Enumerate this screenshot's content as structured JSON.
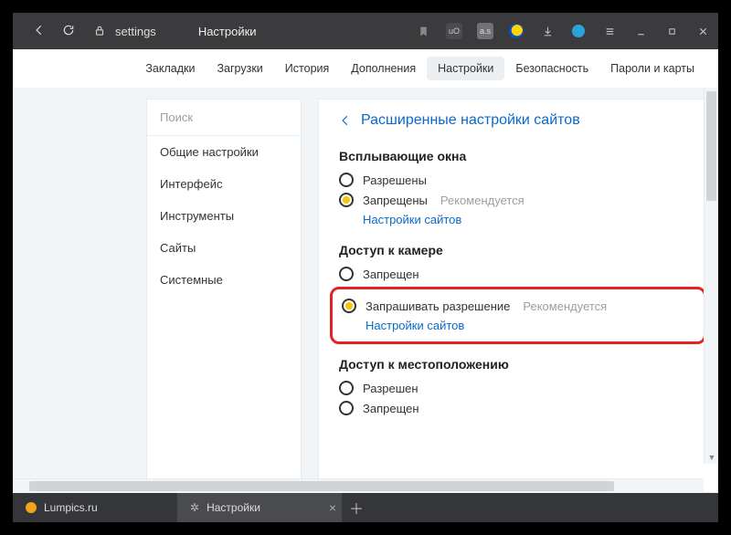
{
  "titlebar": {
    "address_text": "settings",
    "page_title": "Настройки"
  },
  "topTabs": {
    "items": [
      {
        "label": "Закладки"
      },
      {
        "label": "Загрузки"
      },
      {
        "label": "История"
      },
      {
        "label": "Дополнения"
      },
      {
        "label": "Настройки",
        "active": true
      },
      {
        "label": "Безопасность"
      },
      {
        "label": "Пароли и карты"
      }
    ]
  },
  "sidebar": {
    "search_placeholder": "Поиск",
    "items": [
      {
        "label": "Общие настройки"
      },
      {
        "label": "Интерфейс"
      },
      {
        "label": "Инструменты"
      },
      {
        "label": "Сайты"
      },
      {
        "label": "Системные"
      }
    ]
  },
  "main": {
    "breadcrumb_title": "Расширенные настройки сайтов",
    "popups": {
      "title": "Всплывающие окна",
      "opt_allow": "Разрешены",
      "opt_deny": "Запрещены",
      "recommended": "Рекомендуется",
      "link": "Настройки сайтов"
    },
    "camera": {
      "title": "Доступ к камере",
      "opt_deny": "Запрещен",
      "opt_ask": "Запрашивать разрешение",
      "recommended": "Рекомендуется",
      "link": "Настройки сайтов"
    },
    "location": {
      "title": "Доступ к местоположению",
      "opt_allow": "Разрешен",
      "opt_deny": "Запрещен"
    }
  },
  "browserTabs": {
    "tab1": "Lumpics.ru",
    "tab2": "Настройки"
  }
}
